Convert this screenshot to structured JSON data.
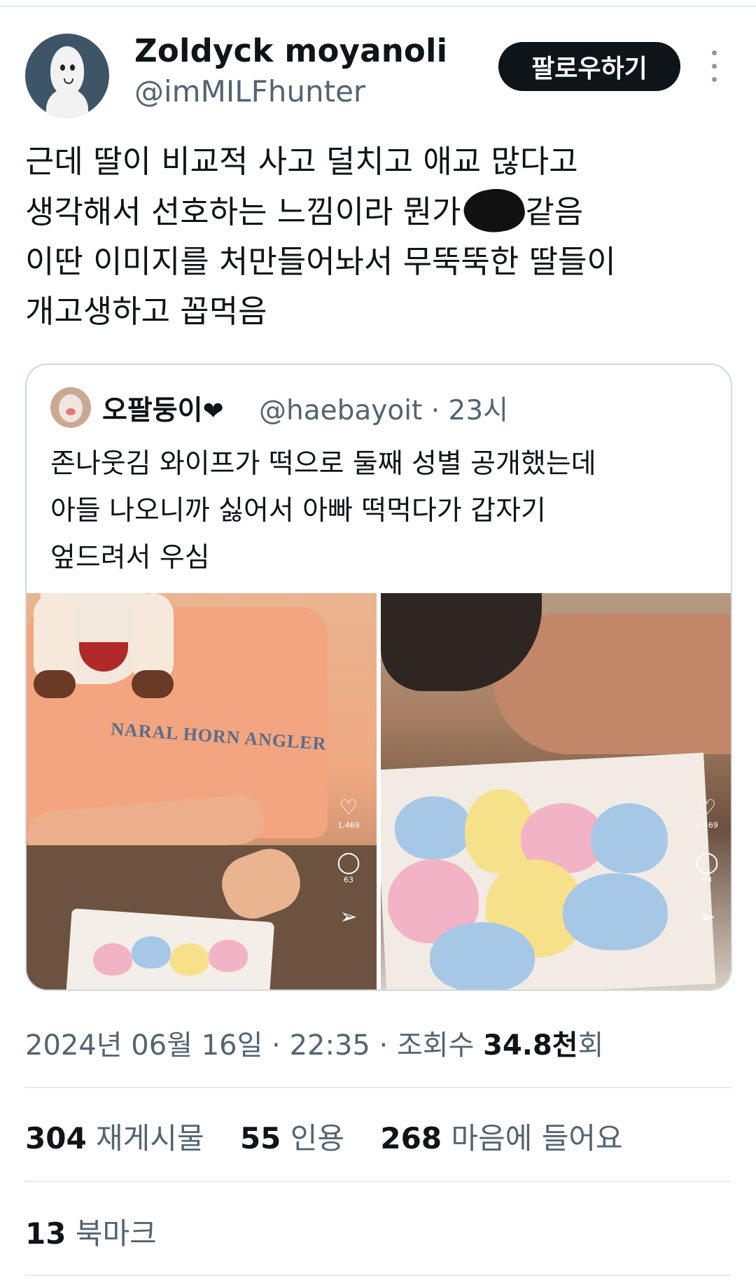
{
  "author": {
    "display_name": "Zoldyck moyanoli",
    "handle": "@imMILFhunter"
  },
  "follow_label": "팔로우하기",
  "tweet": {
    "lines": [
      "근데 딸이 비교적 사고 덜치고 애교 많다고",
      "생각해서 선호하는 느낌이라 뭔가",
      "같음",
      "이딴 이미지를 처만들어놔서 무뚝뚝한 딸들이",
      "개고생하고 꼽먹음"
    ]
  },
  "quote": {
    "display_name": "오팔둥이",
    "heart": "❤",
    "handle_time": "@haebayoit · 23시",
    "lines": [
      "존나웃김 와이프가 떡으로 둘째 성별 공개했는데",
      "아들 나오니까 싫어서 아빠 떡먹다가 갑자기",
      "엎드려서 우심"
    ],
    "photos": [
      {
        "shirt_text": "NARAL HORN ANGLER",
        "likes": "1,469",
        "comments": "63"
      },
      {
        "likes": "1,469",
        "comments": "63"
      }
    ]
  },
  "meta": {
    "date": "2024년 06월 16일 · 22:35 · 조회수",
    "views": "34.8천",
    "views_suffix": "회"
  },
  "stats": {
    "retweets": "304",
    "retweets_label": "재게시물",
    "quotes": "55",
    "quotes_label": "인용",
    "likes": "268",
    "likes_label": "마음에 들어요"
  },
  "bookmarks": {
    "count": "13",
    "label": "북마크"
  },
  "colors": {
    "follow_bg": "#0f1419",
    "secondary_text": "#536471",
    "border": "#cfd9de"
  },
  "icons": {
    "heart": "heart-icon",
    "comment": "comment-icon",
    "share": "share-icon",
    "more": "more-icon"
  }
}
